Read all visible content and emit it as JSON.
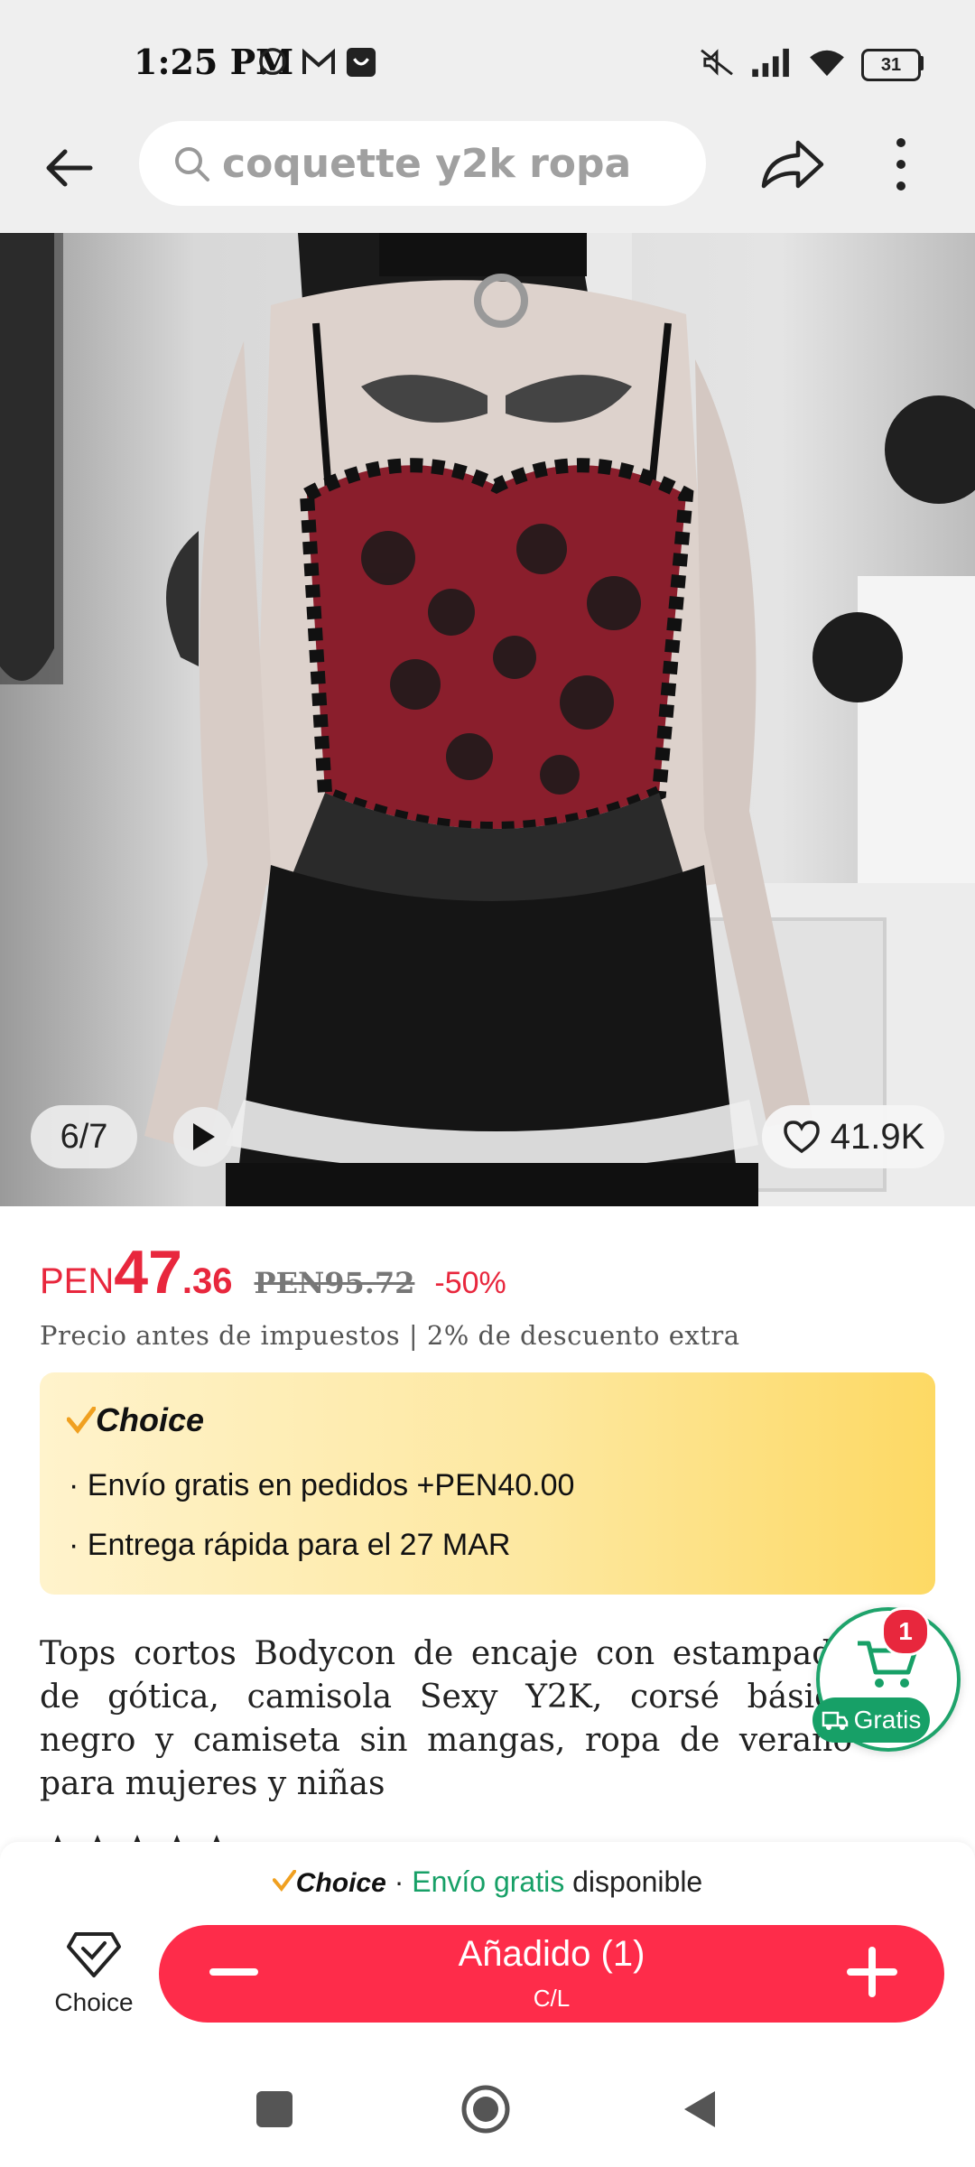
{
  "status_bar": {
    "time": "1:25 PM",
    "battery": "31",
    "icons": [
      "whatsapp-icon",
      "gmail-icon",
      "notification-app-icon",
      "mute-icon",
      "signal-icon",
      "wifi-icon",
      "battery-icon"
    ]
  },
  "header": {
    "search_text": "coquette y2k ropa",
    "icons": [
      "back-arrow-icon",
      "search-icon",
      "share-icon",
      "more-vertical-icon"
    ]
  },
  "gallery": {
    "pager": "6/7",
    "likes": "41.9K"
  },
  "price": {
    "currency": "PEN",
    "integer": "47",
    "decimal": ".36",
    "original": "PEN95.72",
    "discount": "-50%",
    "tax_note": "Precio antes de impuestos | 2% de descuento extra"
  },
  "choice_card": {
    "brand": "Choice",
    "benefits": [
      "· Envío gratis en pedidos +PEN40.00",
      "· Entrega rápida para el 27 MAR"
    ]
  },
  "product": {
    "title": "Tops cortos Bodycon de encaje con estampado de gótica, camisola Sexy Y2K, corsé básico negro y camiseta sin mangas, ropa de verano para mujeres y niñas"
  },
  "floating_cart": {
    "count": "1",
    "label": "Gratis"
  },
  "bottom": {
    "avail_brand": "Choice",
    "avail_sep": " · ",
    "avail_green": "Envío gratis",
    "avail_rest": " disponible",
    "choice_nav_label": "Choice",
    "cta_label": "Añadido (1)",
    "cta_sub": "C/L"
  },
  "colors": {
    "accent_red": "#fe2c4a",
    "price_red": "#e8273d",
    "green": "#17a067",
    "choice_yellow": "#fdd964"
  }
}
